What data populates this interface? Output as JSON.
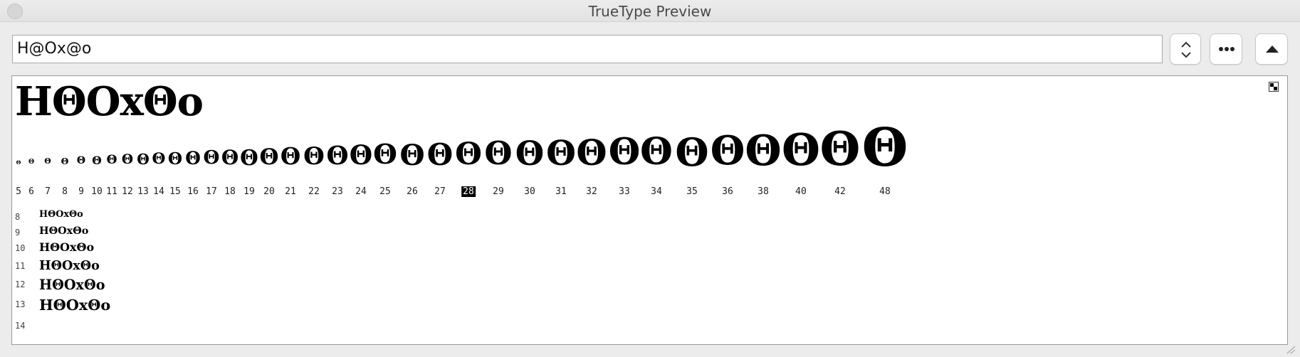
{
  "window": {
    "title": "TrueType Preview"
  },
  "toolbar": {
    "sample_text": "H@Ox@o",
    "stepper_icon": "up-down-chevron",
    "more_icon": "ellipsis",
    "up_icon": "triangle-up"
  },
  "preview": {
    "big_sample": "HΘOxΘo",
    "glyph": "Θ",
    "sizes": [
      "5",
      "6",
      "7",
      "8",
      "9",
      "10",
      "11",
      "12",
      "13",
      "14",
      "15",
      "16",
      "17",
      "18",
      "19",
      "20",
      "21",
      "22",
      "23",
      "24",
      "25",
      "26",
      "27",
      "28",
      "29",
      "30",
      "31",
      "32",
      "33",
      "34",
      "35",
      "36",
      "38",
      "40",
      "42",
      "48"
    ],
    "selected_size": "28",
    "waterfall": [
      {
        "size": "8",
        "text": "HΘOxΘo"
      },
      {
        "size": "9",
        "text": "HΘOxΘo"
      },
      {
        "size": "10",
        "text": "HΘOxΘo"
      },
      {
        "size": "11",
        "text": "HΘOxΘo"
      },
      {
        "size": "12",
        "text": "HΘOxΘo"
      },
      {
        "size": "13",
        "text": "HΘOxΘo"
      },
      {
        "size": "14",
        "text": ""
      }
    ]
  }
}
